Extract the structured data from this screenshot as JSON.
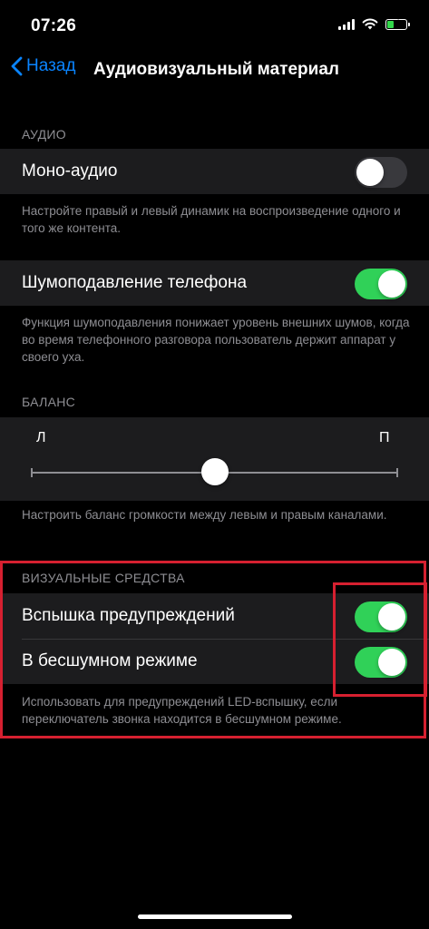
{
  "status_bar": {
    "time": "07:26",
    "battery_level": 0.35,
    "battery_color": "#32d74b",
    "icons": [
      "cellular-signal-icon",
      "wifi-icon",
      "battery-charging-icon"
    ]
  },
  "nav": {
    "back_label": "Назад",
    "title": "Аудиовизуальный материал",
    "back_icon": "chevron-left-icon"
  },
  "audio": {
    "header": "АУДИО",
    "mono": {
      "label": "Моно-аудио",
      "on": false
    },
    "mono_footer": "Настройте правый и левый динамик на воспроизведение одного и того же контента.",
    "noise": {
      "label": "Шумоподавление телефона",
      "on": true
    },
    "noise_footer": "Функция шумоподавления понижает уровень внешних шумов, когда во время телефонного разговора пользователь держит аппарат у своего уха."
  },
  "balance": {
    "header": "БАЛАНС",
    "left_label": "Л",
    "right_label": "П",
    "value": 0.5,
    "footer": "Настроить баланс громкости между левым и правым каналами."
  },
  "visual": {
    "header": "ВИЗУАЛЬНЫЕ СРЕДСТВА",
    "flash": {
      "label": "Вспышка предупреждений",
      "on": true
    },
    "silent": {
      "label": "В бесшумном режиме",
      "on": true
    },
    "footer": "Использовать для предупреждений LED-вспышку, если переключатель звонка находится в бесшумном режиме."
  },
  "colors": {
    "accent": "#0a84ff",
    "toggle_on": "#30d158",
    "toggle_off": "#39393d",
    "highlight": "#d62030"
  }
}
